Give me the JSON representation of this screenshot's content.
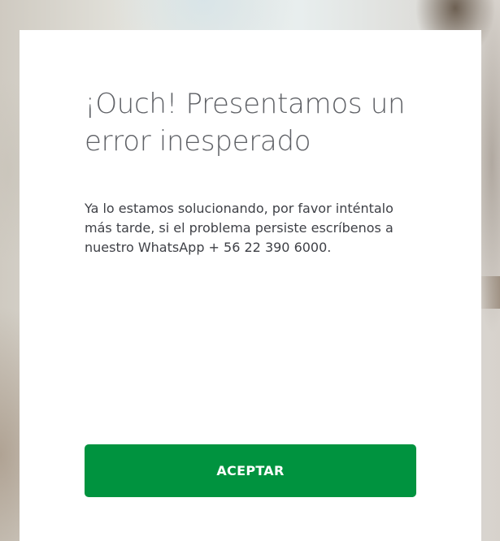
{
  "dialog": {
    "title": "¡Ouch! Presentamos un error inesperado",
    "message": "Ya lo estamos solucionando, por favor inténtalo más tarde, si el problema persiste escríbenos a nuestro WhatsApp + 56 22 390 6000.",
    "accept_label": "ACEPTAR"
  },
  "colors": {
    "accent": "#00933f",
    "title_text": "#5f6166",
    "body_text": "#3f4147",
    "background": "#ffffff"
  }
}
